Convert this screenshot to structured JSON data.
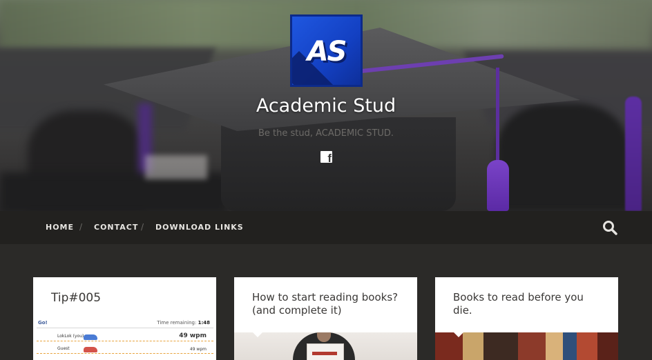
{
  "site": {
    "logo_text": "AS",
    "title": "Academic Stud",
    "tagline": "Be the stud, ACADEMIC STUD.",
    "social_icon": "facebook-icon",
    "social_glyph": "f"
  },
  "nav": {
    "items": [
      {
        "label": "HOME"
      },
      {
        "label": "CONTACT"
      },
      {
        "label": "DOWNLOAD LINKS"
      }
    ],
    "separator": "/",
    "search_icon": "search-icon"
  },
  "posts": [
    {
      "title": "Tip#005",
      "media": {
        "go_label": "Go!",
        "time_label": "Time remaining:",
        "time_value": "1:48",
        "racers": [
          {
            "name": "LokLok (you)",
            "wpm": "49 wpm",
            "car_color": "#4a7bd4"
          },
          {
            "name": "Guest",
            "wpm": "49 wpm",
            "car_color": "#d4534a"
          }
        ]
      }
    },
    {
      "title": "How to start reading books?(and complete it)"
    },
    {
      "title": "Books to read before you die."
    }
  ],
  "colors": {
    "nav_bg": "#22211f",
    "page_bg": "#2b2a28",
    "logo_blue": "#1340c2",
    "accent_purple": "#6d3fb0"
  }
}
